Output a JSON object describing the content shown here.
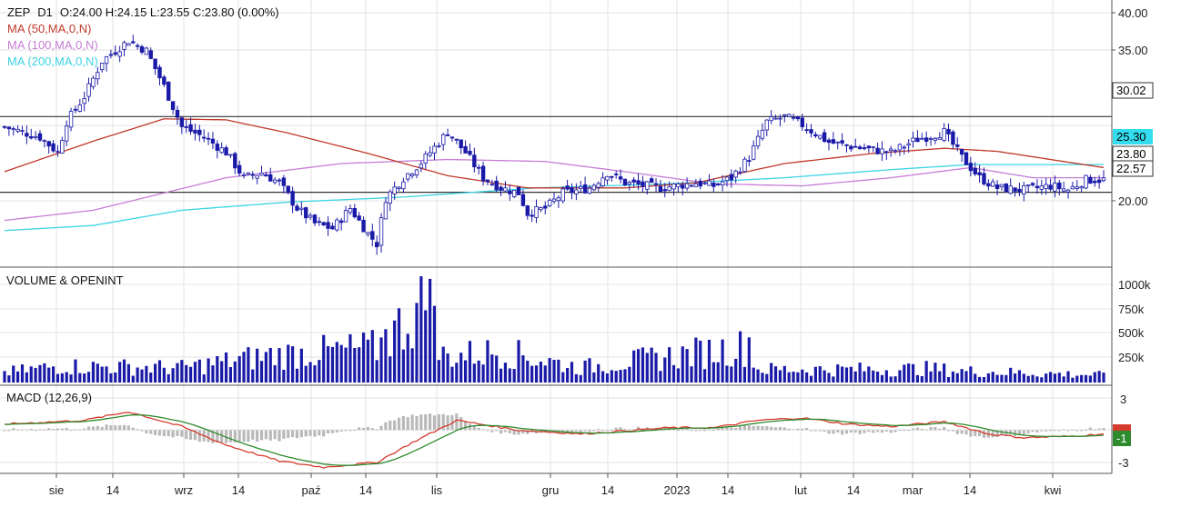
{
  "header": {
    "symbol": "ZEP",
    "interval": "D1",
    "ohlc": "O:24.00  H:24.15  L:23.55  C:23.80  (0.00%)",
    "ma50_label": "MA (50,MA,0,N)",
    "ma100_label": "MA (100,MA,0,N)",
    "ma200_label": "MA (200,MA,0,N)"
  },
  "colors": {
    "candle": "#1a1aa8",
    "ma50": "#c0392b",
    "ma100": "#c77dd6",
    "ma200": "#3cd4e4",
    "macd_line": "#d63b2e",
    "signal_line": "#2e8b2e",
    "histogram": "#b9b9b9",
    "grid": "#e3e3e3",
    "hline": "#333333"
  },
  "x_labels": [
    "sie",
    "14",
    "wrz",
    "14",
    "paź",
    "14",
    "lis",
    "gru",
    "14",
    "2023",
    "14",
    "lut",
    "14",
    "mar",
    "14",
    "kwi"
  ],
  "price_axis": {
    "ticks": [
      "40.00",
      "35.00",
      "25.30",
      "20.00"
    ],
    "hlines": [
      30.02,
      22.57
    ],
    "tags": [
      {
        "value": "30.02",
        "bg": "#ffffff",
        "fg": "#000000"
      },
      {
        "value": "25.30",
        "bg": "#33ddee",
        "fg": "#000000"
      },
      {
        "value": "23.80",
        "bg": "#ffffff",
        "fg": "#000000"
      },
      {
        "value": "22.57",
        "bg": "#ffffff",
        "fg": "#000000"
      }
    ]
  },
  "volume_panel": {
    "title": "VOLUME & OPENINT",
    "ticks": [
      "1000k",
      "750k",
      "500k",
      "250k"
    ]
  },
  "macd_panel": {
    "title": "MACD (12,26,9)",
    "ticks": [
      "3",
      "-3"
    ],
    "tags": [
      {
        "value": "",
        "bg": "#d63b2e"
      },
      {
        "value": "-1",
        "bg": "#2e8b2e"
      }
    ]
  },
  "chart_data": {
    "type": "candlestick",
    "symbol": "ZEP",
    "ylim": [
      15.2,
      41.5
    ],
    "volume_ylim": [
      0,
      1080000
    ],
    "macd_ylim": [
      -3.5,
      3.5
    ],
    "x_ticks": [
      "sie",
      "14",
      "wrz",
      "14",
      "paź",
      "14",
      "lis",
      "gru",
      "14",
      "2023",
      "14",
      "lut",
      "14",
      "mar",
      "14",
      "kwi"
    ],
    "close_keypoints": [
      [
        0,
        29.0
      ],
      [
        8,
        28.0
      ],
      [
        12,
        26.5
      ],
      [
        14,
        29.5
      ],
      [
        18,
        32.0
      ],
      [
        22,
        35.5
      ],
      [
        28,
        37.5
      ],
      [
        32,
        36.5
      ],
      [
        36,
        33.0
      ],
      [
        40,
        29.0
      ],
      [
        45,
        28.0
      ],
      [
        50,
        26.5
      ],
      [
        54,
        24.0
      ],
      [
        58,
        24.5
      ],
      [
        62,
        23.5
      ],
      [
        66,
        21.0
      ],
      [
        70,
        19.5
      ],
      [
        74,
        19.0
      ],
      [
        78,
        21.0
      ],
      [
        82,
        18.5
      ],
      [
        84,
        17.5
      ],
      [
        86,
        22.0
      ],
      [
        90,
        24.0
      ],
      [
        94,
        25.5
      ],
      [
        98,
        27.5
      ],
      [
        100,
        28.5
      ],
      [
        104,
        26.5
      ],
      [
        108,
        24.0
      ],
      [
        112,
        23.0
      ],
      [
        116,
        22.5
      ],
      [
        118,
        20.5
      ],
      [
        122,
        21.0
      ],
      [
        126,
        22.5
      ],
      [
        132,
        23.0
      ],
      [
        136,
        24.5
      ],
      [
        140,
        23.5
      ],
      [
        148,
        23.0
      ],
      [
        156,
        23.5
      ],
      [
        160,
        23.2
      ],
      [
        164,
        24.0
      ],
      [
        168,
        26.0
      ],
      [
        172,
        29.5
      ],
      [
        176,
        30.0
      ],
      [
        180,
        29.2
      ],
      [
        186,
        27.5
      ],
      [
        192,
        27.0
      ],
      [
        200,
        26.5
      ],
      [
        206,
        27.8
      ],
      [
        212,
        28.5
      ],
      [
        216,
        26.0
      ],
      [
        220,
        24.0
      ],
      [
        224,
        23.0
      ],
      [
        230,
        22.8
      ],
      [
        236,
        23.2
      ],
      [
        240,
        22.8
      ],
      [
        244,
        23.8
      ],
      [
        248,
        23.8
      ]
    ],
    "volume_keypoints": [
      [
        0,
        120000
      ],
      [
        12,
        200000
      ],
      [
        40,
        180000
      ],
      [
        60,
        330000
      ],
      [
        84,
        420000
      ],
      [
        86,
        520000
      ],
      [
        96,
        1010000
      ],
      [
        98,
        350000
      ],
      [
        100,
        320000
      ],
      [
        112,
        380000
      ],
      [
        130,
        180000
      ],
      [
        168,
        440000
      ],
      [
        170,
        160000
      ],
      [
        200,
        160000
      ],
      [
        208,
        170000
      ],
      [
        216,
        140000
      ],
      [
        248,
        90000
      ]
    ],
    "macd_keypoints": [
      [
        0,
        0.5
      ],
      [
        18,
        0.8
      ],
      [
        28,
        1.5
      ],
      [
        40,
        0.3
      ],
      [
        50,
        -1.2
      ],
      [
        62,
        -2.5
      ],
      [
        72,
        -3.0
      ],
      [
        84,
        -2.6
      ],
      [
        92,
        -1.0
      ],
      [
        102,
        0.8
      ],
      [
        116,
        0.0
      ],
      [
        130,
        -0.3
      ],
      [
        150,
        0.2
      ],
      [
        160,
        0.2
      ],
      [
        170,
        0.8
      ],
      [
        180,
        1.0
      ],
      [
        190,
        0.5
      ],
      [
        200,
        0.3
      ],
      [
        212,
        0.7
      ],
      [
        222,
        -0.3
      ],
      [
        230,
        -0.6
      ],
      [
        240,
        -0.5
      ],
      [
        248,
        -0.3
      ]
    ],
    "ma50_keypoints": [
      [
        0,
        24.6
      ],
      [
        20,
        27.6
      ],
      [
        36,
        29.8
      ],
      [
        50,
        29.7
      ],
      [
        64,
        28.4
      ],
      [
        82,
        26.4
      ],
      [
        100,
        24.2
      ],
      [
        118,
        23.0
      ],
      [
        140,
        23.0
      ],
      [
        156,
        23.5
      ],
      [
        176,
        25.4
      ],
      [
        196,
        26.4
      ],
      [
        212,
        26.9
      ],
      [
        224,
        26.6
      ],
      [
        248,
        25.0
      ]
    ],
    "ma100_keypoints": [
      [
        0,
        19.8
      ],
      [
        20,
        20.8
      ],
      [
        50,
        24.0
      ],
      [
        76,
        25.4
      ],
      [
        100,
        25.8
      ],
      [
        122,
        25.6
      ],
      [
        140,
        24.6
      ],
      [
        160,
        23.4
      ],
      [
        180,
        23.2
      ],
      [
        200,
        24.0
      ],
      [
        218,
        25.0
      ],
      [
        232,
        24.0
      ],
      [
        248,
        24.0
      ]
    ],
    "ma200_keypoints": [
      [
        0,
        18.8
      ],
      [
        20,
        19.3
      ],
      [
        40,
        20.8
      ],
      [
        64,
        21.6
      ],
      [
        90,
        22.1
      ],
      [
        120,
        23.0
      ],
      [
        150,
        23.4
      ],
      [
        176,
        24.0
      ],
      [
        200,
        24.8
      ],
      [
        218,
        25.3
      ],
      [
        248,
        25.3
      ]
    ]
  }
}
